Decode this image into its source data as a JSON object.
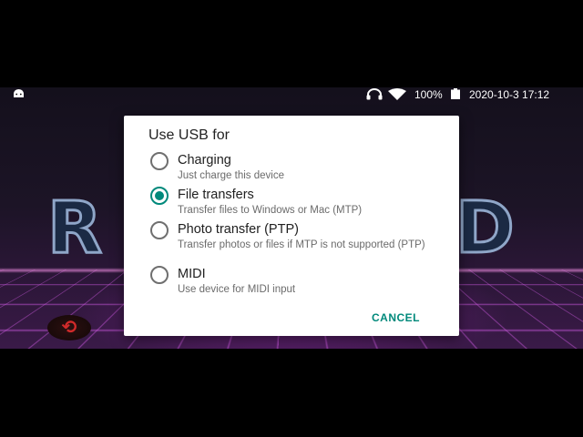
{
  "status_bar": {
    "icons": [
      "android-icon",
      "headset-icon",
      "wifi-icon",
      "battery-icon"
    ],
    "battery": "100%",
    "datetime": "2020-10-3 17:12"
  },
  "wallpaper": {
    "logo_left": "R",
    "logo_right": "D"
  },
  "dialog": {
    "title": "Use USB for",
    "options": [
      {
        "label": "Charging",
        "description": "Just charge this device",
        "selected": false
      },
      {
        "label": "File transfers",
        "description": "Transfer files to Windows or Mac (MTP)",
        "selected": true
      },
      {
        "label": "Photo transfer (PTP)",
        "description": "Transfer photos or files if MTP is not supported (PTP)",
        "selected": false
      },
      {
        "label": "MIDI",
        "description": "Use device for MIDI input",
        "selected": false
      }
    ],
    "cancel_label": "CANCEL"
  },
  "colors": {
    "accent": "#00897b",
    "dialog_bg": "#ffffff",
    "backdrop": "#000000"
  }
}
